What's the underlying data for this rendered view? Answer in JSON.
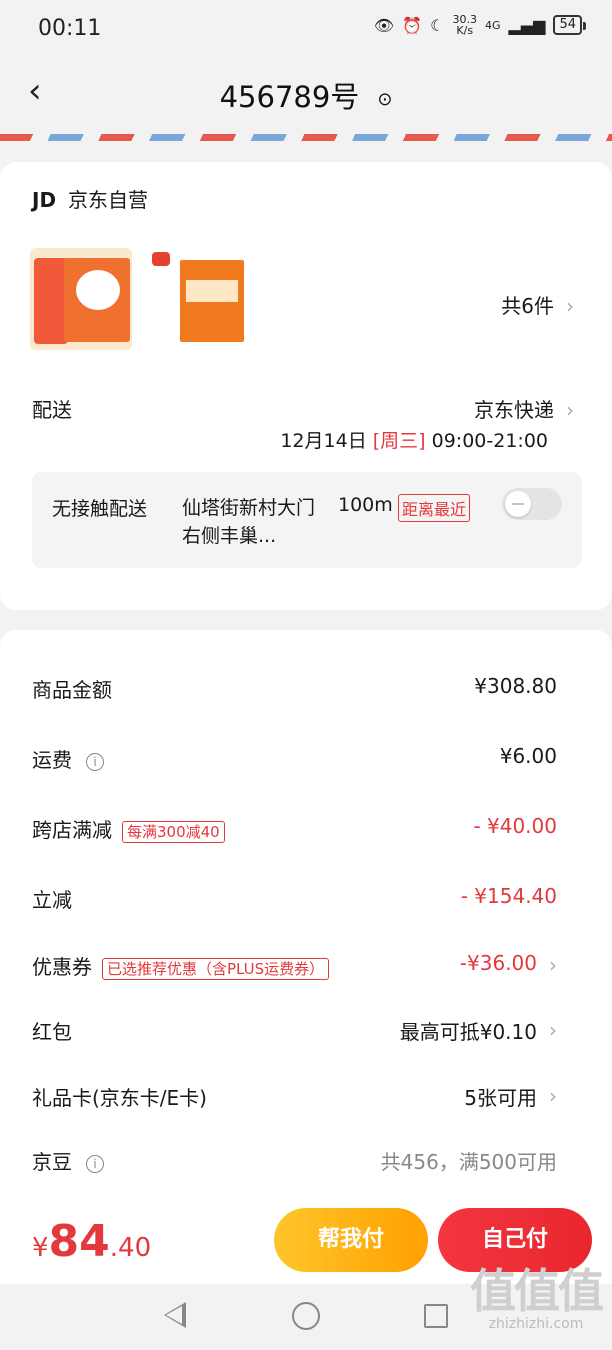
{
  "status": {
    "time": "00:11",
    "net_speed_top": "30.3",
    "net_speed_unit": "K/s",
    "network": "4G",
    "battery": "54"
  },
  "header": {
    "title": "456789号"
  },
  "shop": {
    "logo": "JD",
    "name": "京东自营"
  },
  "products": {
    "count_label": "共6件"
  },
  "delivery": {
    "label": "配送",
    "carrier": "京东快递",
    "date": "12月14日",
    "weekday": "[周三]",
    "hours": "09:00-21:00",
    "contactless": {
      "title": "无接触配送",
      "address": "仙塔街新村大门右侧丰巢...",
      "distance": "100m",
      "tag": "距离最近",
      "enabled": false
    }
  },
  "summary": {
    "goods": {
      "label": "商品金额",
      "value": "¥308.80"
    },
    "shipping": {
      "label": "运费",
      "value": "¥6.00"
    },
    "cross_store": {
      "label": "跨店满减",
      "tag": "每满300减40",
      "value": "- ¥40.00"
    },
    "instant": {
      "label": "立减",
      "value": "- ¥154.40"
    },
    "coupon": {
      "label": "优惠券",
      "tag": "已选推荐优惠（含PLUS运费券）",
      "value": "-¥36.00"
    },
    "red_packet": {
      "label": "红包",
      "value": "最高可抵¥0.10"
    },
    "gift_card": {
      "label": "礼品卡(京东卡/E卡)",
      "value": "5张可用"
    },
    "jingdou": {
      "label": "京豆",
      "value": "共456，满500可用"
    }
  },
  "bottom": {
    "price_symbol": "¥",
    "price_int": "84",
    "price_dec": ".40",
    "help_pay": "帮我付",
    "self_pay": "自己付"
  },
  "watermark": {
    "big": "值值值",
    "small": "zhizhizhi.com"
  },
  "colors": {
    "accent_red": "#e4393c",
    "help_yellow": "#ffb31a",
    "pay_red": "#f0303a"
  }
}
